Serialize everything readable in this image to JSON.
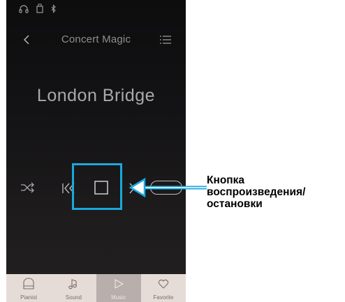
{
  "status_bar": {
    "icons": [
      "headphones-icon",
      "usb-memory-icon",
      "bluetooth-icon"
    ]
  },
  "header": {
    "back_icon": "chevron-left-icon",
    "title": "Concert Magic",
    "menu_icon": "list-icon"
  },
  "song_title": "London Bridge",
  "controls": {
    "items": [
      "shuffle-icon",
      "skip-previous-icon",
      "play-stop-icon",
      "skip-next-icon",
      "toggle-pill"
    ]
  },
  "tabs": [
    {
      "label": "Pianist",
      "icon": "piano-icon",
      "active": false
    },
    {
      "label": "Sound",
      "icon": "music-note-icon",
      "active": false
    },
    {
      "label": "Music",
      "icon": "play-icon",
      "active": true
    },
    {
      "label": "Favorite",
      "icon": "heart-icon",
      "active": false
    }
  ],
  "callout": {
    "lines": [
      "Кнопка",
      "воспроизведения/",
      "остановки"
    ],
    "color": "#1aa8dc"
  },
  "colors": {
    "accent": "#1aa8dc",
    "tab_bar": "#e6dcd7",
    "tab_active": "#b8aeab"
  }
}
